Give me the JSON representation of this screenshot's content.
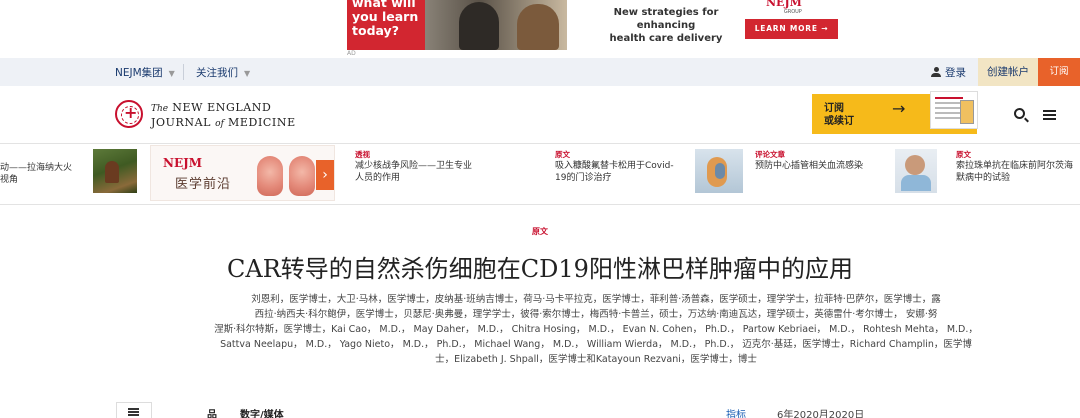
{
  "ad": {
    "headline_lines": [
      "what will",
      "you learn",
      "today?"
    ],
    "ad_label": "AD",
    "tagline_lines": [
      "New strategies for enhancing",
      "health care delivery"
    ],
    "brand": "NEJM",
    "brand_sub": "GROUP",
    "button": "LEARN MORE →"
  },
  "util": {
    "group": "NEJM集团",
    "about": "关注我们",
    "login": "登录",
    "create_account": "创建帐户",
    "subscribe": "订阅"
  },
  "header": {
    "masthead_line1_prefix": "The",
    "masthead_line1": "NEW ENGLAND",
    "masthead_line2_a": "JOURNAL",
    "masthead_line2_of": "of",
    "masthead_line2_b": "MEDICINE",
    "promo_line1": "订阅",
    "promo_line2": "或续订",
    "promo_arrow": "→"
  },
  "ticker": {
    "item1_lines": [
      "动——拉海纳大火",
      "视角"
    ],
    "promo_logo": "NEJM",
    "promo_zh": "医学前沿",
    "promo_go": "›",
    "item2": {
      "tag": "透视",
      "lines": [
        "减少核战争风险——卫生专业",
        "人员的作用"
      ]
    },
    "item3": {
      "tag": "原文",
      "lines": [
        "吸入糠酸氟替卡松用于Covid-",
        "19的门诊治疗"
      ]
    },
    "item4": {
      "tag": "评论文章",
      "lines": [
        "预防中心插管相关血流感染"
      ]
    },
    "item5": {
      "tag": "原文",
      "lines": [
        "索拉珠单抗在临床前阿尔茨海",
        "默病中的试验"
      ]
    }
  },
  "article": {
    "kind": "原文",
    "title": "CAR转导的自然杀伤细胞在CD19阳性淋巴样肿瘤中的应用",
    "authors_lines": [
      "刘恩利，医学博士，大卫·马林，医学博士，皮纳基·班纳吉博士，荷马·马卡平拉克，医学博士，菲利普·汤普森，医学硕士，理学学士，拉菲特·巴萨尔，医学博士，露",
      "西拉·纳西夫·科尔鲍伊，医学博士，贝瑟尼·奥弗曼，理学学士，彼得·索尔博士，梅西特·卡普兰，硕士，万达纳·南迪瓦达，理学硕士，英德雷什·考尔博士，  安娜·努",
      "涅斯·科尔特斯，医学博士，Kai Cao， M.D.， May Daher， M.D.， Chitra Hosing， M.D.， Evan N. Cohen， Ph.D.， Partow Kebriaei， M.D.， Rohtesh Mehta， M.D.，",
      "Sattva Neelapu， M.D.， Yago Nieto， M.D.， Ph.D.， Michael Wang， M.D.， William Wierda， M.D.， Ph.D.， 迈克尔·基廷，医学博士，Richard Champlin，医学博",
      "士，Elizabeth J. Shpall，医学博士和Katayoun Rezvani，医学博士，博士"
    ]
  },
  "bottom": {
    "label1": "品",
    "label2": "数字/媒体",
    "metrics": "指标",
    "date": "6年2020月2020日"
  }
}
